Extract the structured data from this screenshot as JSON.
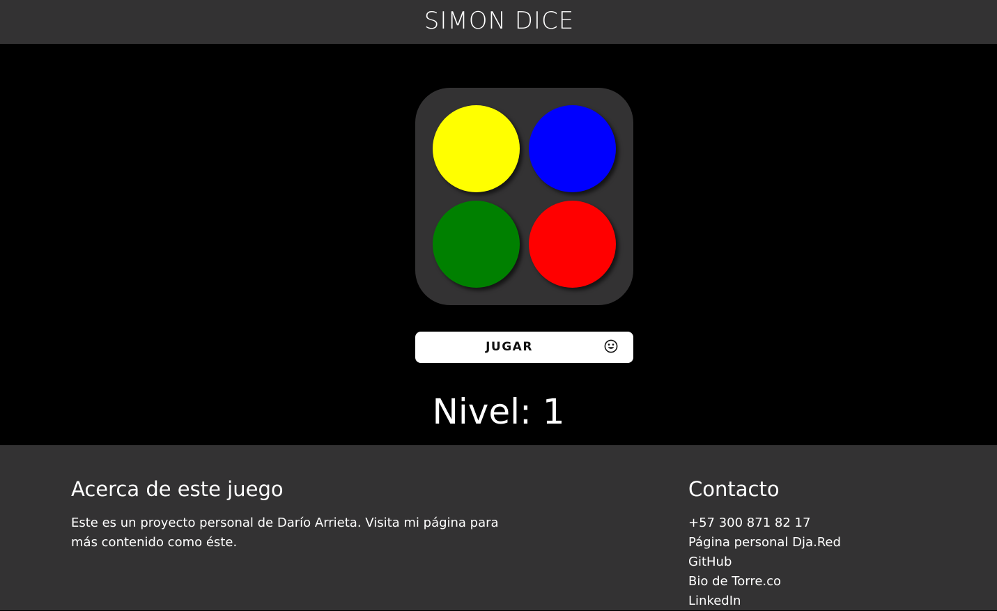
{
  "header": {
    "title": "SIMON DICE"
  },
  "game": {
    "pads": [
      {
        "name": "yellow",
        "color": "#ffff00"
      },
      {
        "name": "blue",
        "color": "#0000ff"
      },
      {
        "name": "green",
        "color": "#008000"
      },
      {
        "name": "red",
        "color": "#ff0000"
      }
    ],
    "board_color": "#333233",
    "play_button": {
      "label": "JUGAR",
      "icon": "smiley-face-icon"
    },
    "level_text": "Nivel: 1"
  },
  "footer": {
    "about": {
      "heading": "Acerca de este juego",
      "text": "Este es un proyecto personal de Darío Arrieta. Visita mi página para más contenido como éste."
    },
    "contact": {
      "heading": "Contacto",
      "items": [
        "+57 300 871 82 17",
        "Página personal Dja.Red",
        "GitHub",
        "Bio de Torre.co",
        "LinkedIn"
      ]
    }
  }
}
